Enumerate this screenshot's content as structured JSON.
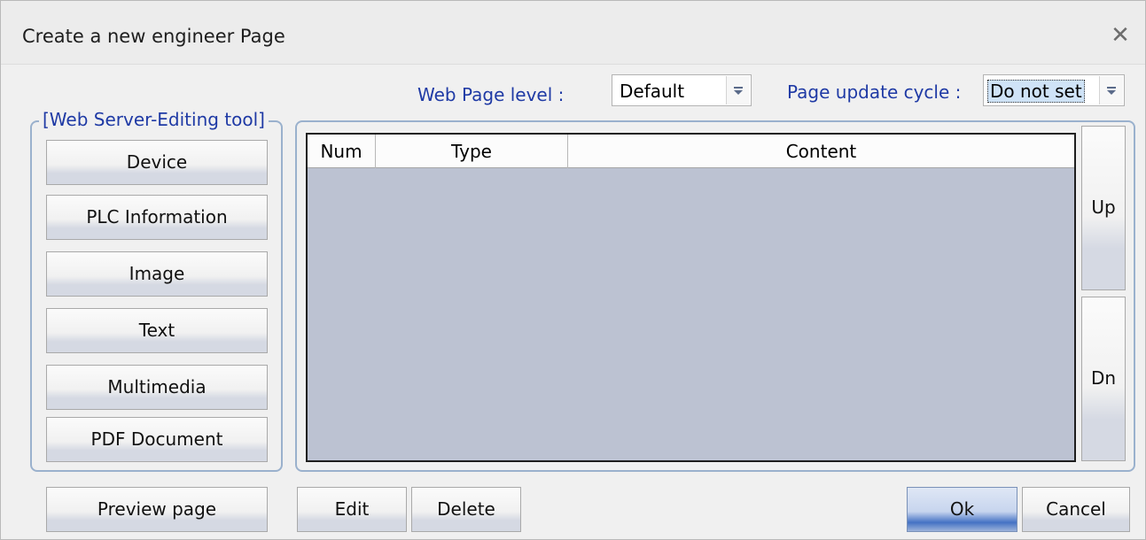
{
  "window": {
    "title": "Create a new engineer Page",
    "close_glyph": "✕"
  },
  "web_page_level": {
    "label": "Web Page level :",
    "value": "Default"
  },
  "page_update_cycle": {
    "label": "Page update cycle :",
    "value": "Do not set"
  },
  "tool_group": {
    "legend": "[Web Server-Editing tool]",
    "buttons": [
      "Device",
      "PLC Information",
      "Image",
      "Text",
      "Multimedia",
      "PDF Document"
    ]
  },
  "table": {
    "columns": [
      "Num",
      "Type",
      "Content"
    ],
    "rows": []
  },
  "side_buttons": {
    "up": "Up",
    "down": "Dn"
  },
  "bottom_buttons": {
    "preview": "Preview page",
    "edit": "Edit",
    "delete": "Delete",
    "ok": "Ok",
    "cancel": "Cancel"
  }
}
